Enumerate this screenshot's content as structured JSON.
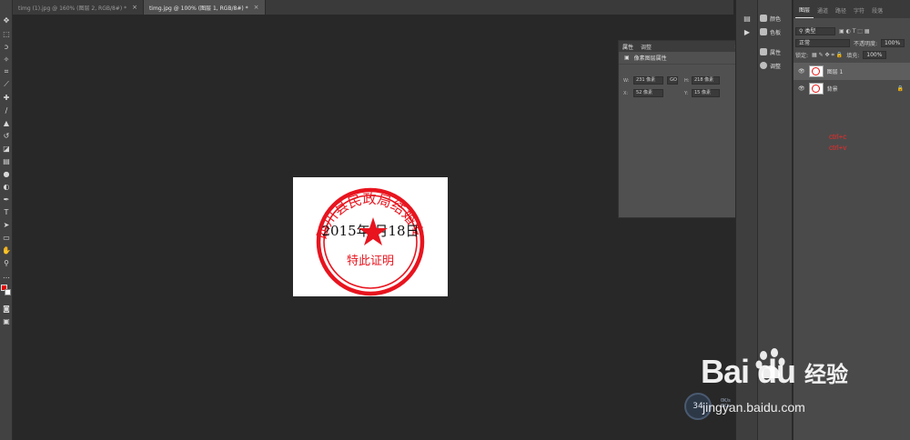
{
  "tabs": [
    {
      "label": "timg (1).jpg @ 160% (图层 2, RGB/8#) *",
      "close": "×"
    },
    {
      "label": "timg.jpg @ 100% (图层 1, RGB/8#) *",
      "close": "×"
    }
  ],
  "toolbar": {
    "icons": [
      "move-icon",
      "marquee-icon",
      "lasso-icon",
      "magic-wand-icon",
      "crop-icon",
      "eyedropper-icon",
      "healing-brush-icon",
      "brush-icon",
      "stamp-icon",
      "history-brush-icon",
      "eraser-icon",
      "gradient-icon",
      "blur-icon",
      "dodge-icon",
      "pen-icon",
      "type-icon",
      "path-select-icon",
      "shape-icon",
      "hand-icon",
      "zoom-icon",
      "more-icon"
    ]
  },
  "stamp": {
    "arc_text": "四川县民政局结婚专用",
    "date": "2015年 月18日",
    "bottom": "特此证明",
    "color": "#e8141e"
  },
  "properties": {
    "tabs": [
      "属性",
      "调整"
    ],
    "section": "像素图层属性",
    "w_label": "W:",
    "w_value": "231 像素",
    "link": "GO",
    "h_label": "H:",
    "h_value": "218 像素",
    "x_label": "X:",
    "x_value": "52 像素",
    "y_label": "Y:",
    "y_value": "15 像素"
  },
  "dock2": {
    "items": [
      "颜色",
      "色板",
      "属性",
      "调整"
    ]
  },
  "layers": {
    "tabs": [
      "图层",
      "通道",
      "路径",
      "字符",
      "段落"
    ],
    "filter": "类型",
    "blend": "正常",
    "opacity_label": "不透明度:",
    "opacity": "100%",
    "lock_label": "锁定:",
    "fill_label": "填充:",
    "fill": "100%",
    "items": [
      {
        "name": "图层 1"
      },
      {
        "name": "背景"
      }
    ]
  },
  "notes": [
    "ctrl+c",
    "ctrl+v"
  ],
  "watermark": {
    "logo": "Bai  du",
    "brand": "经验",
    "url": "jingyan.baidu.com",
    "badge": "34",
    "speed_up": "0K/s",
    "speed_down": "0K/s"
  }
}
